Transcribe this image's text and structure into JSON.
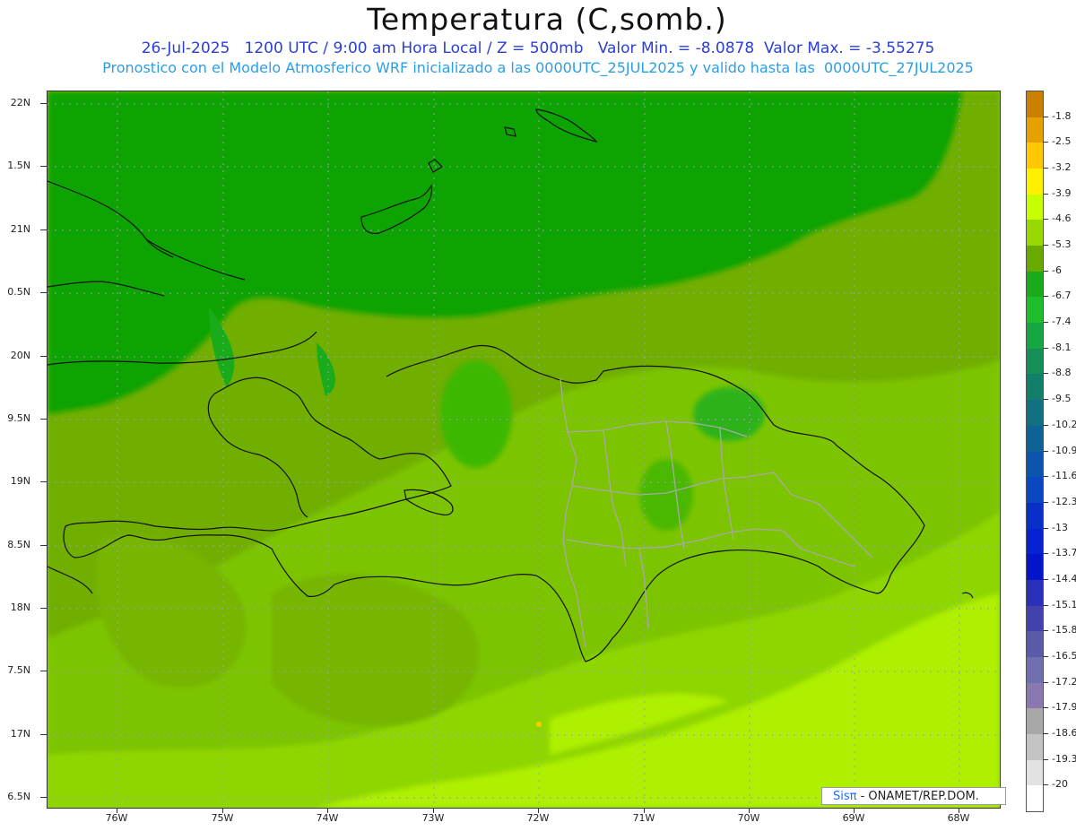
{
  "title": "Temperatura (C,somb.)",
  "subtitle_line1": "26-Jul-2025   1200 UTC / 9:00 am Hora Local / Z = 500mb   Valor Min. = -8.0878  Valor Max. = -3.55275",
  "subtitle_line2": "Pronostico con el Modelo Atmosferico WRF inicializado a las 0000UTC_25JUL2025 y valido hasta las  0000UTC_27JUL2025",
  "credit": {
    "logo": "Sisπ",
    "text": " - ONAMET/REP.DOM."
  },
  "lat_labels": [
    "22N",
    "1.5N",
    "21N",
    "0.5N",
    "20N",
    "9.5N",
    "19N",
    "8.5N",
    "18N",
    "7.5N",
    "17N",
    "6.5N"
  ],
  "lon_labels": [
    "76W",
    "75W",
    "74W",
    "73W",
    "72W",
    "71W",
    "70W",
    "69W",
    "68W"
  ],
  "colorbar": {
    "labels": [
      "-1.8",
      "-2.5",
      "-3.2",
      "-3.9",
      "-4.6",
      "-5.3",
      "-6",
      "-6.7",
      "-7.4",
      "-8.1",
      "-8.8",
      "-9.5",
      "-10.2",
      "-10.9",
      "-11.6",
      "-12.3",
      "-13",
      "-13.7",
      "-14.4",
      "-15.1",
      "-15.8",
      "-16.5",
      "-17.2",
      "-17.9",
      "-18.6",
      "-19.3",
      "-20"
    ],
    "colors": [
      "#c97f00",
      "#e8a000",
      "#ffc800",
      "#fff000",
      "#c8ff00",
      "#96d800",
      "#6aaa00",
      "#1aab1a",
      "#1fbd2c",
      "#17a742",
      "#158f57",
      "#127f6a",
      "#117080",
      "#0e6296",
      "#0c55ad",
      "#0a47c3",
      "#0830c8",
      "#0622d0",
      "#0414c8",
      "#2a30b8",
      "#4242ad",
      "#5a5aa8",
      "#7070b0",
      "#8a78b0",
      "#a8a8a8",
      "#c4c4c4",
      "#e2e2e2",
      "#ffffff"
    ]
  }
}
